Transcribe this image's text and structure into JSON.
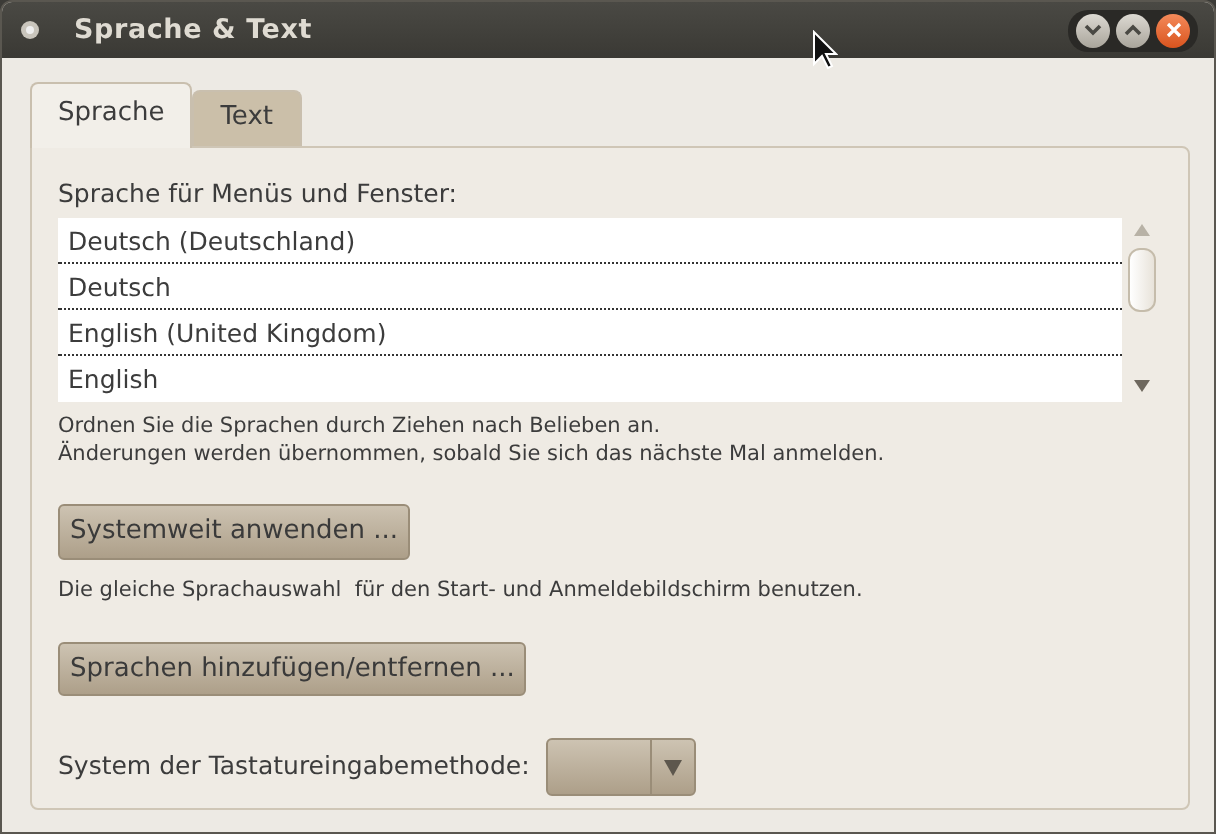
{
  "window": {
    "title": "Sprache & Text"
  },
  "tabs": [
    {
      "label": "Sprache",
      "selected": true
    },
    {
      "label": "Text",
      "selected": false
    }
  ],
  "languages": {
    "label": "Sprache für Menüs und Fenster:",
    "items": [
      {
        "label": "Deutsch (Deutschland)"
      },
      {
        "label": "Deutsch"
      },
      {
        "label": "English (United Kingdom)"
      },
      {
        "label": "English"
      }
    ],
    "hint_lines": [
      "Ordnen Sie die Sprachen durch Ziehen nach Belieben an.",
      "Änderungen werden übernommen, sobald Sie sich das nächste Mal anmelden."
    ]
  },
  "apply_button": "Systemweit anwenden ...",
  "apply_hint": "Die gleiche Sprachauswahl  für den Start- und Anmeldebildschirm benutzen.",
  "add_button": "Sprachen hinzufügen/entfernen ...",
  "input_method": {
    "label": "System der Tastatureingabemethode:"
  }
}
